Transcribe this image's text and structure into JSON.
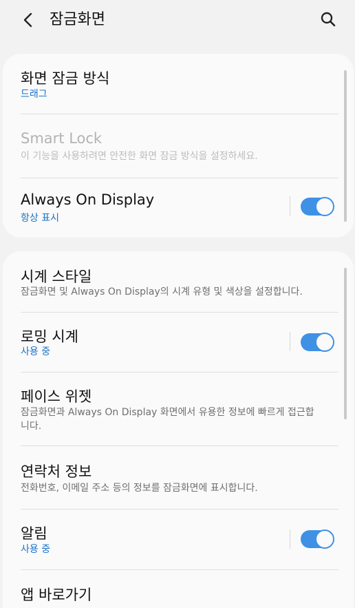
{
  "header": {
    "title": "잠금화면",
    "back_icon": "chevron-left-icon",
    "search_icon": "search-icon"
  },
  "accent_color": "#3e91e4",
  "section1": {
    "lock_type": {
      "title": "화면 잠금 방식",
      "subtitle": "드래그"
    },
    "smart_lock": {
      "title": "Smart Lock",
      "subtitle": "이 기능을 사용하려면 안전한 화면 잠금 방식을 설정하세요.",
      "enabled": false
    },
    "aod": {
      "title": "Always On Display",
      "subtitle": "항상 표시",
      "toggle_on": true
    }
  },
  "section2": {
    "clock_style": {
      "title": "시계 스타일",
      "subtitle": "잠금화면 및 Always On Display의 시계 유형 및 색상을 설정합니다."
    },
    "roaming_clock": {
      "title": "로밍 시계",
      "subtitle": "사용 중",
      "toggle_on": true
    },
    "face_widgets": {
      "title": "페이스 위젯",
      "subtitle": "잠금화면과 Always On Display 화면에서 유용한 정보에 빠르게 접근합니다."
    },
    "contact_info": {
      "title": "연락처 정보",
      "subtitle": "전화번호, 이메일 주소 등의 정보를 잠금화면에 표시합니다."
    },
    "notifications": {
      "title": "알림",
      "subtitle": "사용 중",
      "toggle_on": true
    },
    "app_shortcuts": {
      "title": "앱 바로가기"
    }
  }
}
